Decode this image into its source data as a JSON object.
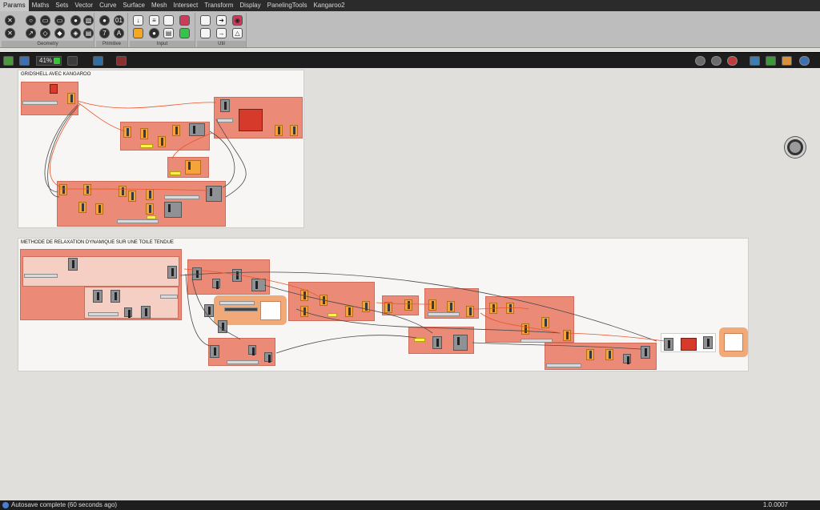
{
  "tabs": [
    "Params",
    "Maths",
    "Sets",
    "Vector",
    "Curve",
    "Surface",
    "Mesh",
    "Intersect",
    "Transform",
    "Display",
    "PanelingTools",
    "Kangaroo2"
  ],
  "ribbon": {
    "groups": [
      "Geometry",
      "Primitive",
      "Input",
      "Util"
    ],
    "icons": {
      "geometry": [
        "✕",
        "○",
        "▭",
        "▭",
        "●",
        "▧",
        "✕",
        "↗",
        "◇",
        "◆",
        "◈",
        "▤"
      ],
      "primitive": [
        "●",
        "01",
        "7",
        "A"
      ],
      "input": [
        "↓",
        "≡",
        "●",
        "▤"
      ],
      "util": [
        "➜",
        "→",
        "◉",
        "△"
      ]
    }
  },
  "toolbar": {
    "zoom": "41%"
  },
  "canvas": {
    "groups": [
      {
        "title": "GRIDSHELL AVEC KANGAROO"
      },
      {
        "title": "METHODE DE RELAXATION DYNAMIQUE SUR UNE TOILE TENDUE"
      }
    ]
  },
  "status": {
    "message": "Autosave complete (60 seconds ago)",
    "version": "1.0.0007"
  },
  "colors": {
    "accent": "#f4a43a",
    "cluster": "#ec8a78",
    "background": "#e0dfdb",
    "zoom_toggle": "#3cc13b"
  }
}
